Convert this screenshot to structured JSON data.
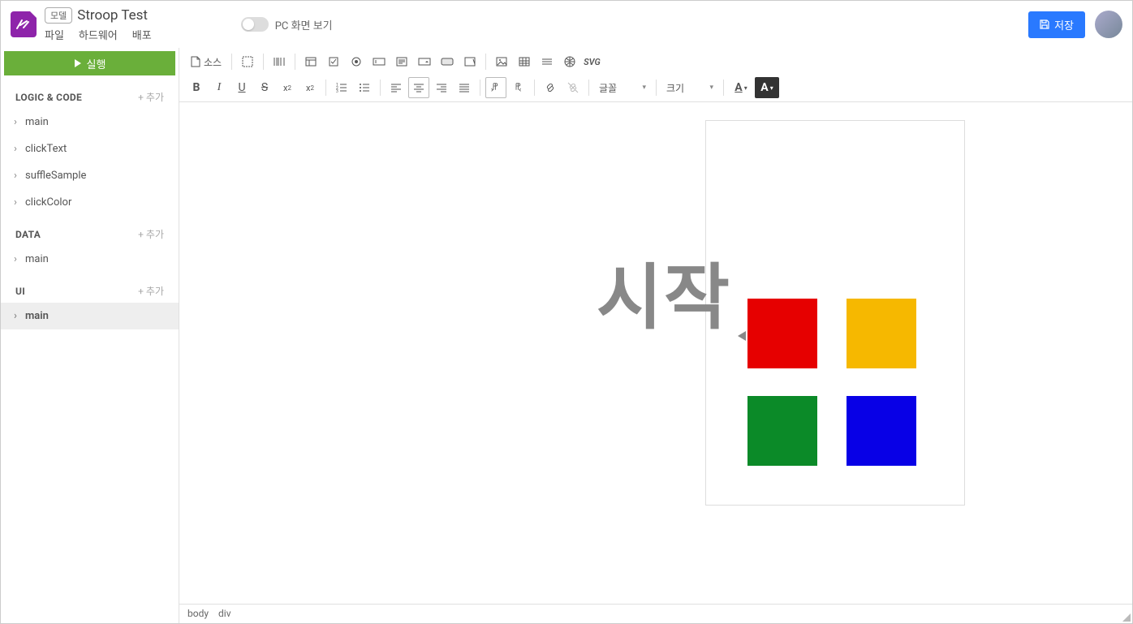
{
  "header": {
    "badge": "모델",
    "title": "Stroop Test",
    "menu": [
      "파일",
      "하드웨어",
      "배포"
    ],
    "toggle_label": "PC 화면 보기",
    "save_label": "저장"
  },
  "sidebar": {
    "run_label": "실행",
    "add_label": "+ 추가",
    "sections": {
      "logic": {
        "title": "LOGIC & CODE",
        "items": [
          "main",
          "clickText",
          "suffleSample",
          "clickColor"
        ]
      },
      "data": {
        "title": "DATA",
        "items": [
          "main"
        ]
      },
      "ui": {
        "title": "UI",
        "items": [
          "main"
        ],
        "selected": 0
      }
    }
  },
  "toolbar": {
    "source_label": "소스",
    "font_label": "글꼴",
    "size_label": "크기",
    "svg_label": "SVG"
  },
  "canvas": {
    "big_text": "시작",
    "colors": {
      "red": "#e60000",
      "orange": "#f6b800",
      "green": "#0b8a28",
      "blue": "#0800e6"
    }
  },
  "status": {
    "path": [
      "body",
      "div"
    ]
  }
}
